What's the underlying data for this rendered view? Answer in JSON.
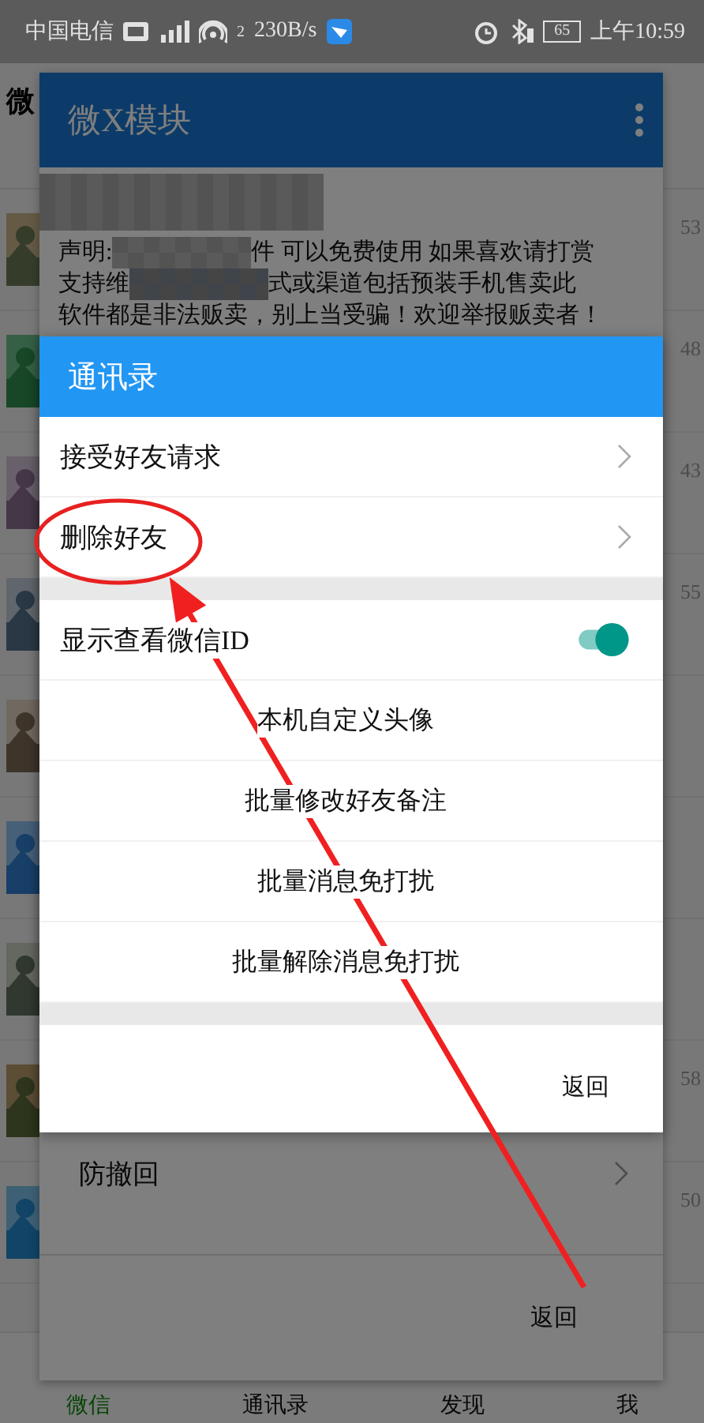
{
  "status_bar": {
    "carrier": "中国电信",
    "hotspot_count": "2",
    "network_speed": "230B/s",
    "battery": "65",
    "time": "上午10:59"
  },
  "app_header": {
    "title": "微"
  },
  "chats": [
    {
      "avatar": {
        "kind": "picture"
      },
      "time": "53"
    },
    {
      "avatar": {
        "kind": "picture"
      },
      "time": "48"
    },
    {
      "avatar": {
        "kind": "picture"
      },
      "time": "43"
    },
    {
      "avatar": {
        "kind": "picture"
      },
      "time": "55"
    },
    {
      "avatar": {
        "kind": "picture"
      }
    },
    {
      "avatar": {
        "kind": "picture"
      }
    },
    {
      "avatar": {
        "kind": "picture"
      }
    },
    {
      "avatar": {
        "kind": "picture"
      },
      "time": "58"
    },
    {
      "avatar": {
        "kind": "picture"
      },
      "time": "50"
    }
  ],
  "tab_bar": [
    {
      "label": "微信",
      "selected": true
    },
    {
      "label": "通讯录",
      "selected": false
    },
    {
      "label": "发现",
      "selected": false
    },
    {
      "label": "我",
      "selected": false
    }
  ],
  "module_dialog": {
    "title": "微X模块",
    "statement_lines": [
      [
        "声明:",
        "件 可以免费使用 如果喜欢请打赏"
      ],
      [
        "支持维",
        "式或渠道包括预装手机售卖此"
      ],
      [
        "软件都是非法贩卖，别上当受骗！欢迎举报贩卖者！"
      ]
    ],
    "items": [
      {
        "kind": "link",
        "label": "防撤回"
      }
    ],
    "footer_button": "返回"
  },
  "contacts_dialog": {
    "title": "通讯录",
    "groups": [
      [
        {
          "kind": "link",
          "label": "接受好友请求"
        },
        {
          "kind": "link",
          "label": "删除好友"
        }
      ],
      [
        {
          "kind": "switch",
          "label": "显示查看微信ID",
          "on": true
        },
        {
          "kind": "action",
          "label": "本机自定义头像"
        },
        {
          "kind": "action",
          "label": "批量修改好友备注"
        },
        {
          "kind": "action",
          "label": "批量消息免打扰"
        },
        {
          "kind": "action",
          "label": "批量解除消息免打扰"
        }
      ]
    ],
    "footer_button": "返回"
  }
}
